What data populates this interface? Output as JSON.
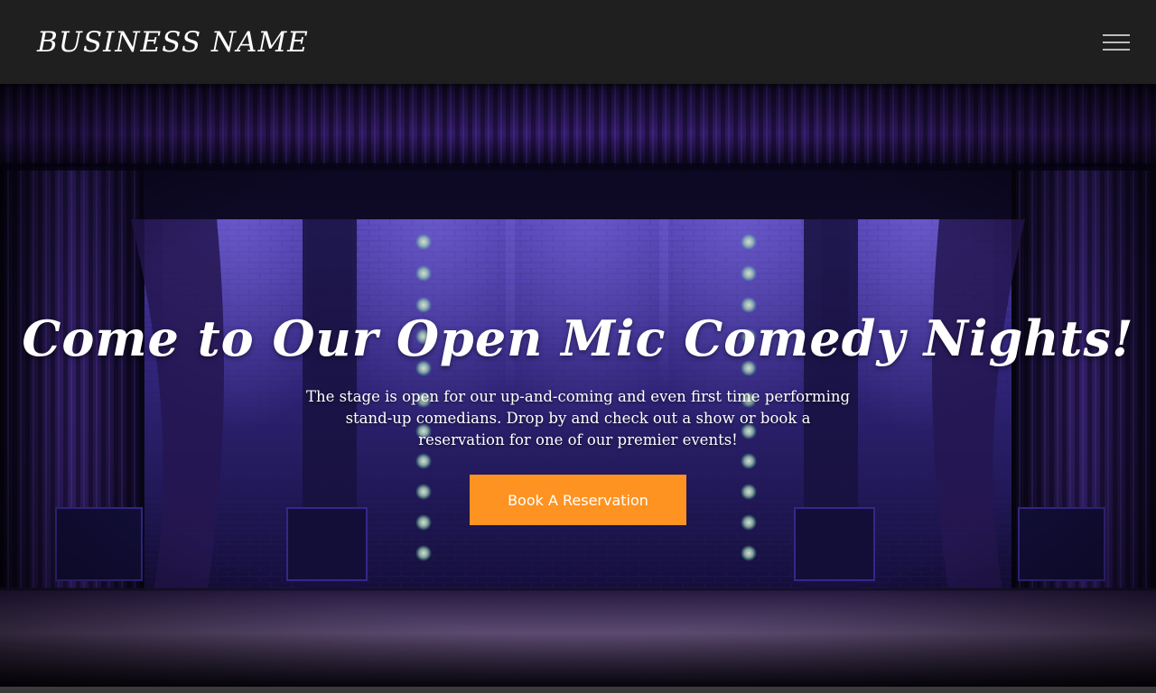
{
  "header": {
    "brand": "BUSINESS NAME",
    "menu_icon": "hamburger-menu-icon"
  },
  "hero": {
    "headline": "Come to Our Open Mic Comedy Nights!",
    "lead": "The stage is open for our up-and-coming and even first time performing stand-up comedians. Drop by and check out a show or book a reservation for one of our premier events!",
    "cta_label": "Book A Reservation",
    "background": "theater-stage-photo"
  },
  "colors": {
    "header_bg": "#1f1f1f",
    "accent": "#fe9321",
    "stage_purple": "#3b2a8a",
    "text": "#ffffff"
  }
}
